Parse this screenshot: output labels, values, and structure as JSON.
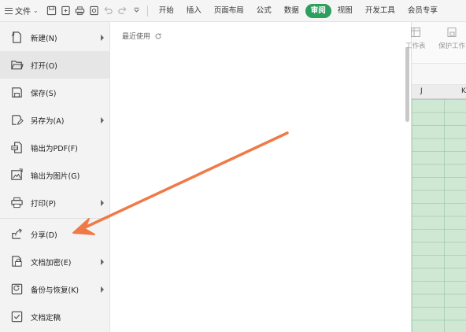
{
  "toolbar": {
    "file_label": "文件",
    "tabs": [
      {
        "label": "开始",
        "active": false
      },
      {
        "label": "插入",
        "active": false
      },
      {
        "label": "页面布局",
        "active": false
      },
      {
        "label": "公式",
        "active": false
      },
      {
        "label": "数据",
        "active": false
      },
      {
        "label": "审阅",
        "active": true
      },
      {
        "label": "视图",
        "active": false
      },
      {
        "label": "开发工具",
        "active": false
      },
      {
        "label": "会员专享",
        "active": false
      }
    ],
    "active_tab_color": "#2e9e5e"
  },
  "menu": {
    "items": [
      {
        "label": "新建(N)",
        "icon": "new-file-icon",
        "submenu": true
      },
      {
        "label": "打开(O)",
        "icon": "folder-open-icon",
        "submenu": false,
        "hover": true
      },
      {
        "label": "保存(S)",
        "icon": "save-icon",
        "submenu": false
      },
      {
        "label": "另存为(A)",
        "icon": "save-as-icon",
        "submenu": true
      },
      {
        "label": "输出为PDF(F)",
        "icon": "pdf-icon",
        "submenu": false
      },
      {
        "label": "输出为图片(G)",
        "icon": "image-export-icon",
        "submenu": false
      },
      {
        "label": "打印(P)",
        "icon": "printer-icon",
        "submenu": true
      },
      {
        "label": "分享(D)",
        "icon": "share-icon",
        "submenu": false
      },
      {
        "label": "文档加密(E)",
        "icon": "encrypt-icon",
        "submenu": true
      },
      {
        "label": "备份与恢复(K)",
        "icon": "backup-icon",
        "submenu": true
      },
      {
        "label": "文档定稿",
        "icon": "finalize-icon",
        "submenu": false
      }
    ]
  },
  "recent": {
    "title": "最近使用"
  },
  "sheet": {
    "ribbon_buttons": [
      {
        "label": "工作表",
        "icon": "worksheet-icon"
      },
      {
        "label": "保护工作",
        "icon": "protect-sheet-icon"
      }
    ],
    "columns": [
      "J",
      "K"
    ],
    "cell_fill": "#cfe8d4"
  },
  "annotation": {
    "arrow_color": "#f07a47"
  }
}
